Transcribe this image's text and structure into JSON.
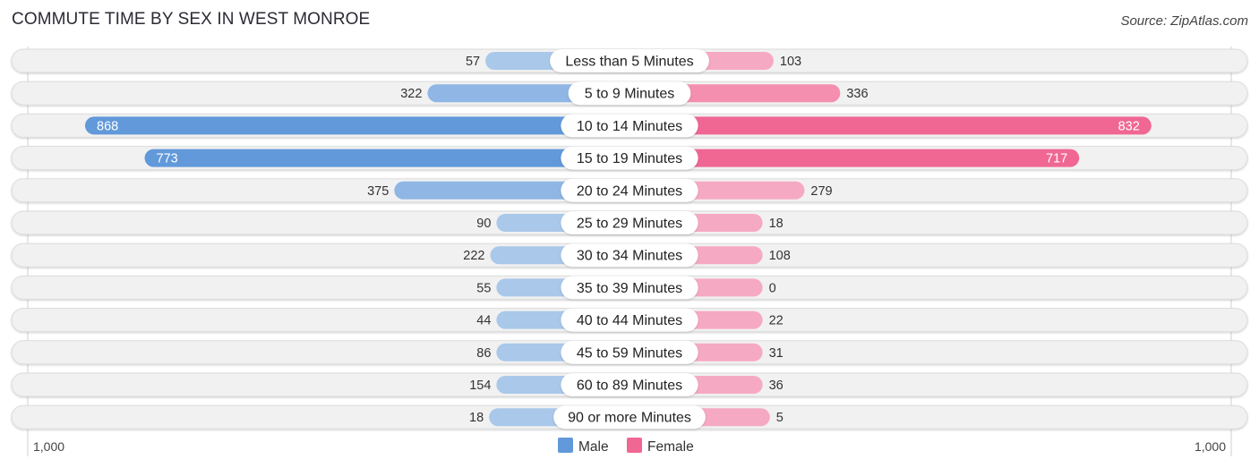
{
  "title": "COMMUTE TIME BY SEX IN WEST MONROE",
  "source": "Source: ZipAtlas.com",
  "colors": {
    "male_strong": "#6199da",
    "male_light": "#a9c8ea",
    "female_strong": "#f06793",
    "female_light": "#f6a9c2",
    "row_bg": "#f1f1f1",
    "row_border": "#dcdcdc"
  },
  "chart_data": {
    "type": "bar",
    "orientation": "horizontal-butterfly",
    "title": "COMMUTE TIME BY SEX IN WEST MONROE",
    "categories": [
      "Less than 5 Minutes",
      "5 to 9 Minutes",
      "10 to 14 Minutes",
      "15 to 19 Minutes",
      "20 to 24 Minutes",
      "25 to 29 Minutes",
      "30 to 34 Minutes",
      "35 to 39 Minutes",
      "40 to 44 Minutes",
      "45 to 59 Minutes",
      "60 to 89 Minutes",
      "90 or more Minutes"
    ],
    "series": [
      {
        "name": "Male",
        "values": [
          57,
          322,
          868,
          773,
          375,
          90,
          222,
          55,
          44,
          86,
          154,
          18
        ]
      },
      {
        "name": "Female",
        "values": [
          103,
          336,
          832,
          717,
          279,
          18,
          108,
          0,
          22,
          31,
          36,
          5
        ]
      }
    ],
    "axis": {
      "left_label": "1,000",
      "right_label": "1,000",
      "max": 1000
    },
    "value_labels": {
      "Male": [
        "57",
        "322",
        "868",
        "773",
        "375",
        "90",
        "222",
        "55",
        "44",
        "86",
        "154",
        "18"
      ],
      "Female": [
        "103",
        "336",
        "832",
        "717",
        "279",
        "18",
        "108",
        "0",
        "22",
        "31",
        "36",
        "5"
      ]
    },
    "legend": {
      "position": "bottom-center",
      "entries": [
        "Male",
        "Female"
      ]
    },
    "grid": false
  }
}
